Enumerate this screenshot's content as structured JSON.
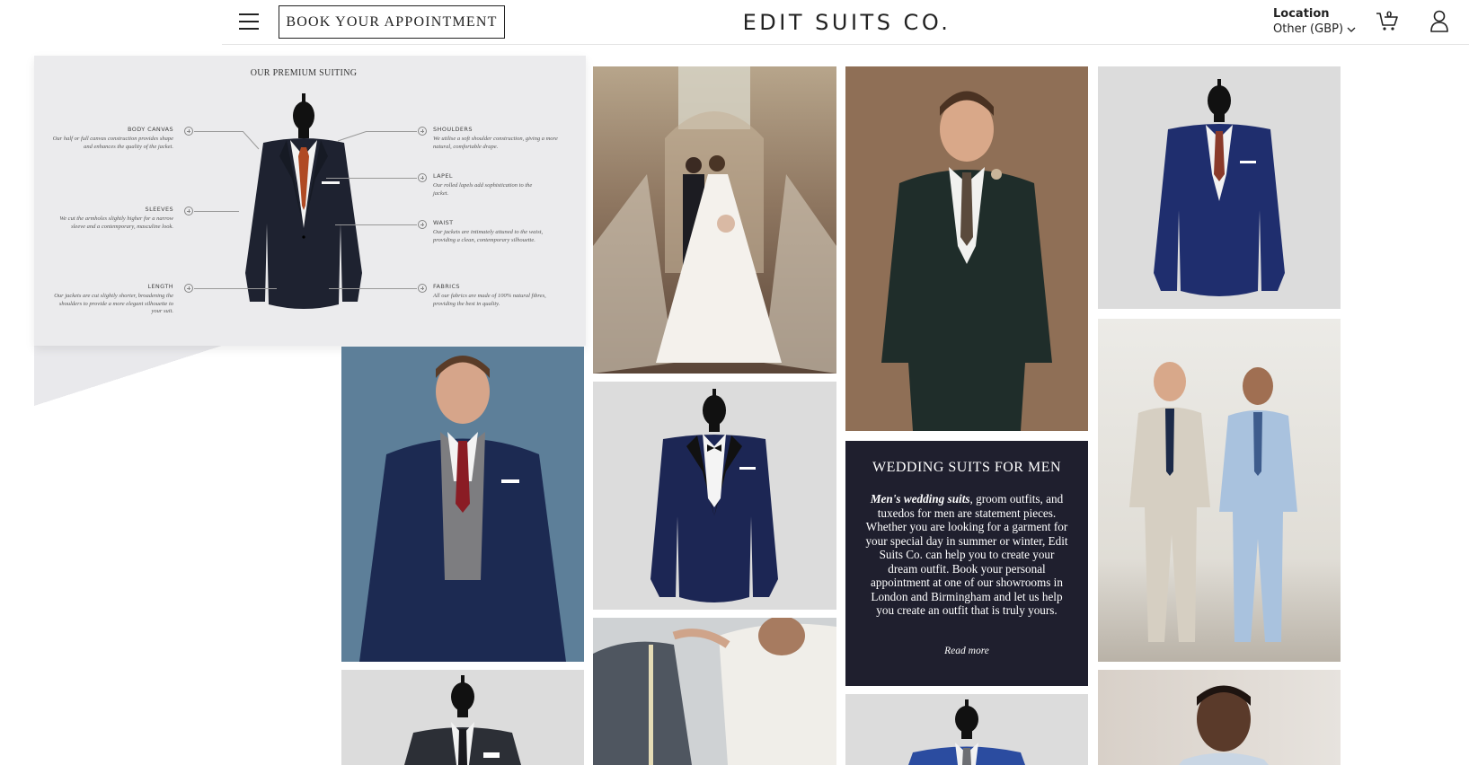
{
  "header": {
    "book_button": "BOOK YOUR APPOINTMENT",
    "logo": "EDIT SUITS CO.",
    "location_label": "Location",
    "location_value": "Other (GBP)",
    "cart_count": "0"
  },
  "diagram": {
    "title": "OUR PREMIUM SUITING",
    "left": [
      {
        "title": "BODY CANVAS",
        "desc": "Our half or full canvas construction provides shape and enhances the quality of the jacket."
      },
      {
        "title": "SLEEVES",
        "desc": "We cut the armholes slightly higher for a narrow sleeve and a contemporary, masculine look."
      },
      {
        "title": "LENGTH",
        "desc": "Our jackets are cut slightly shorter, broadening the shoulders to provide a more elegant silhouette to your suit."
      }
    ],
    "right": [
      {
        "title": "SHOULDERS",
        "desc": "We utilise a soft shoulder construction, giving a more natural, comfortable drape."
      },
      {
        "title": "LAPEL",
        "desc": "Our rolled lapels add sophistication to the jacket."
      },
      {
        "title": "WAIST",
        "desc": "Our jackets are intimately attuned to the waist, providing a clean, contemporary silhouette."
      },
      {
        "title": "FABRICS",
        "desc": "All our fabrics are made of 100% natural fibres, providing the best in quality."
      }
    ]
  },
  "promo": {
    "heading": "WEDDING SUITS FOR MEN",
    "body_bold": "Men's wedding suits",
    "body_rest": ", groom outfits, and tuxedos for men are statement pieces. Whether you are looking for a garment for your special day in summer or winter, Edit Suits Co. can help you to create your dream outfit. Book your personal appointment at one of our showrooms in London and Birmingham and let us help you create an outfit that is truly yours.",
    "read_more": "Read more"
  },
  "colors": {
    "navy": "#1f2a5a",
    "promo_bg": "#1f1f2e",
    "grey_bg": "#dcdcdc"
  }
}
